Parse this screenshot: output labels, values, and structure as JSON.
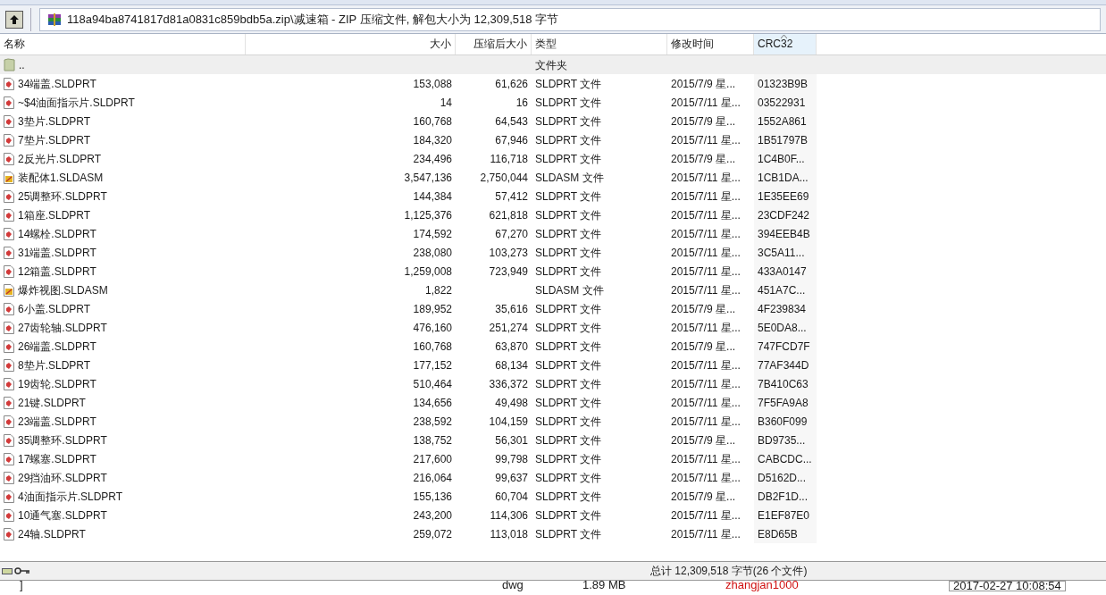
{
  "address": "118a94ba8741817d81a0831c859bdb5a.zip\\减速箱 - ZIP 压缩文件, 解包大小为 12,309,518 字节",
  "columns": [
    {
      "label": "名称",
      "sorted": false
    },
    {
      "label": "大小",
      "sorted": false
    },
    {
      "label": "压缩后大小",
      "sorted": false
    },
    {
      "label": "类型",
      "sorted": false
    },
    {
      "label": "修改时间",
      "sorted": false
    },
    {
      "label": "CRC32",
      "sorted": true
    }
  ],
  "rows": [
    {
      "kind": "folder",
      "name": "..",
      "size": "",
      "packed": "",
      "type": "文件夹",
      "modified": "",
      "crc": ""
    },
    {
      "kind": "part",
      "name": "34端盖.SLDPRT",
      "size": "153,088",
      "packed": "61,626",
      "type": "SLDPRT 文件",
      "modified": "2015/7/9 星...",
      "crc": "01323B9B"
    },
    {
      "kind": "part",
      "name": "~$4油面指示片.SLDPRT",
      "size": "14",
      "packed": "16",
      "type": "SLDPRT 文件",
      "modified": "2015/7/11 星...",
      "crc": "03522931"
    },
    {
      "kind": "part",
      "name": "3垫片.SLDPRT",
      "size": "160,768",
      "packed": "64,543",
      "type": "SLDPRT 文件",
      "modified": "2015/7/9 星...",
      "crc": "1552A861"
    },
    {
      "kind": "part",
      "name": "7垫片.SLDPRT",
      "size": "184,320",
      "packed": "67,946",
      "type": "SLDPRT 文件",
      "modified": "2015/7/11 星...",
      "crc": "1B51797B"
    },
    {
      "kind": "part",
      "name": "2反光片.SLDPRT",
      "size": "234,496",
      "packed": "116,718",
      "type": "SLDPRT 文件",
      "modified": "2015/7/9 星...",
      "crc": "1C4B0F..."
    },
    {
      "kind": "assembly",
      "name": "装配体1.SLDASM",
      "size": "3,547,136",
      "packed": "2,750,044",
      "type": "SLDASM 文件",
      "modified": "2015/7/11 星...",
      "crc": "1CB1DA..."
    },
    {
      "kind": "part",
      "name": "25调整环.SLDPRT",
      "size": "144,384",
      "packed": "57,412",
      "type": "SLDPRT 文件",
      "modified": "2015/7/11 星...",
      "crc": "1E35EE69"
    },
    {
      "kind": "part",
      "name": "1箱座.SLDPRT",
      "size": "1,125,376",
      "packed": "621,818",
      "type": "SLDPRT 文件",
      "modified": "2015/7/11 星...",
      "crc": "23CDF242"
    },
    {
      "kind": "part",
      "name": "14螺栓.SLDPRT",
      "size": "174,592",
      "packed": "67,270",
      "type": "SLDPRT 文件",
      "modified": "2015/7/11 星...",
      "crc": "394EEB4B"
    },
    {
      "kind": "part",
      "name": "31端盖.SLDPRT",
      "size": "238,080",
      "packed": "103,273",
      "type": "SLDPRT 文件",
      "modified": "2015/7/11 星...",
      "crc": "3C5A11..."
    },
    {
      "kind": "part",
      "name": "12箱盖.SLDPRT",
      "size": "1,259,008",
      "packed": "723,949",
      "type": "SLDPRT 文件",
      "modified": "2015/7/11 星...",
      "crc": "433A0147"
    },
    {
      "kind": "assembly",
      "name": "爆炸视图.SLDASM",
      "size": "1,822",
      "packed": "",
      "type": "SLDASM 文件",
      "modified": "2015/7/11 星...",
      "crc": "451A7C..."
    },
    {
      "kind": "part",
      "name": "6小盖.SLDPRT",
      "size": "189,952",
      "packed": "35,616",
      "type": "SLDPRT 文件",
      "modified": "2015/7/9 星...",
      "crc": "4F239834"
    },
    {
      "kind": "part",
      "name": "27齿轮轴.SLDPRT",
      "size": "476,160",
      "packed": "251,274",
      "type": "SLDPRT 文件",
      "modified": "2015/7/11 星...",
      "crc": "5E0DA8..."
    },
    {
      "kind": "part",
      "name": "26端盖.SLDPRT",
      "size": "160,768",
      "packed": "63,870",
      "type": "SLDPRT 文件",
      "modified": "2015/7/9 星...",
      "crc": "747FCD7F"
    },
    {
      "kind": "part",
      "name": "8垫片.SLDPRT",
      "size": "177,152",
      "packed": "68,134",
      "type": "SLDPRT 文件",
      "modified": "2015/7/11 星...",
      "crc": "77AF344D"
    },
    {
      "kind": "part",
      "name": "19齿轮.SLDPRT",
      "size": "510,464",
      "packed": "336,372",
      "type": "SLDPRT 文件",
      "modified": "2015/7/11 星...",
      "crc": "7B410C63"
    },
    {
      "kind": "part",
      "name": "21键.SLDPRT",
      "size": "134,656",
      "packed": "49,498",
      "type": "SLDPRT 文件",
      "modified": "2015/7/11 星...",
      "crc": "7F5FA9A8"
    },
    {
      "kind": "part",
      "name": "23端盖.SLDPRT",
      "size": "238,592",
      "packed": "104,159",
      "type": "SLDPRT 文件",
      "modified": "2015/7/11 星...",
      "crc": "B360F099"
    },
    {
      "kind": "part",
      "name": "35调整环.SLDPRT",
      "size": "138,752",
      "packed": "56,301",
      "type": "SLDPRT 文件",
      "modified": "2015/7/9 星...",
      "crc": "BD9735..."
    },
    {
      "kind": "part",
      "name": "17螺塞.SLDPRT",
      "size": "217,600",
      "packed": "99,798",
      "type": "SLDPRT 文件",
      "modified": "2015/7/11 星...",
      "crc": "CABCDC..."
    },
    {
      "kind": "part",
      "name": "29挡油环.SLDPRT",
      "size": "216,064",
      "packed": "99,637",
      "type": "SLDPRT 文件",
      "modified": "2015/7/11 星...",
      "crc": "D5162D..."
    },
    {
      "kind": "part",
      "name": "4油面指示片.SLDPRT",
      "size": "155,136",
      "packed": "60,704",
      "type": "SLDPRT 文件",
      "modified": "2015/7/9 星...",
      "crc": "DB2F1D..."
    },
    {
      "kind": "part",
      "name": "10通气塞.SLDPRT",
      "size": "243,200",
      "packed": "114,306",
      "type": "SLDPRT 文件",
      "modified": "2015/7/11 星...",
      "crc": "E1EF87E0"
    },
    {
      "kind": "part",
      "name": "24轴.SLDPRT",
      "size": "259,072",
      "packed": "113,018",
      "type": "SLDPRT 文件",
      "modified": "2015/7/11 星...",
      "crc": "E8D65B"
    }
  ],
  "status": "总计 12,309,518 字节(26 个文件)",
  "background_row": [
    "]",
    "dwg",
    "1.89 MB",
    "zhangjan1000",
    "2017-02-27 10:08:54"
  ]
}
